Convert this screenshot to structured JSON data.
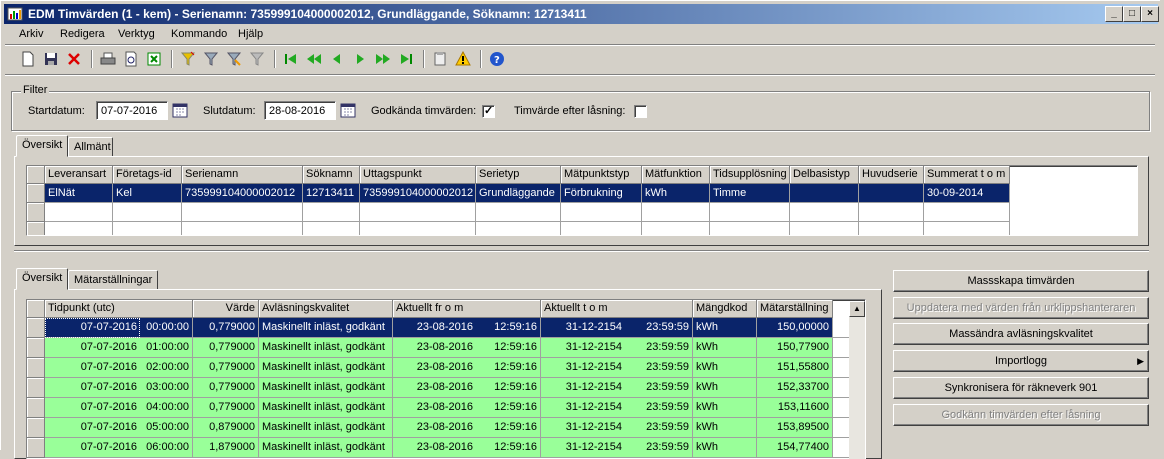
{
  "window": {
    "title": "EDM Timvärden (1 - kem) - Serienamn: 735999104000002012, Grundläggande, Söknamn: 12713411"
  },
  "menu": [
    "Arkiv",
    "Redigera",
    "Verktyg",
    "Kommando",
    "Hjälp"
  ],
  "filter": {
    "group_label": "Filter",
    "start_label": "Startdatum:",
    "start_value": "07-07-2016",
    "end_label": "Slutdatum:",
    "end_value": "28-08-2016",
    "approved_label": "Godkända timvärden:",
    "approved_checked": true,
    "after_lock_label": "Timvärde efter låsning:",
    "after_lock_checked": false
  },
  "upper_tabs": [
    "Översikt",
    "Allmänt"
  ],
  "series_table": {
    "columns": [
      "Leveransart",
      "Företags-id",
      "Serienamn",
      "Söknamn",
      "Uttagspunkt",
      "Serietyp",
      "Mätpunktstyp",
      "Mätfunktion",
      "Tidsupplösning",
      "Delbasistyp",
      "Huvudserie",
      "Summerat t o m"
    ],
    "rows": [
      [
        "ElNät",
        "Kel",
        "735999104000002012",
        "12713411",
        "735999104000002012",
        "Grundläggande",
        "Förbrukning",
        "kWh",
        "Timme",
        "",
        "",
        "30-09-2014"
      ]
    ]
  },
  "lower_tabs": [
    "Översikt",
    "Mätarställningar"
  ],
  "values_table": {
    "columns": [
      "Tidpunkt (utc)",
      "Värde",
      "Avläsningskvalitet",
      "Aktuellt fr o m",
      "Aktuellt t o m",
      "Mängdkod",
      "Mätarställning"
    ],
    "rows": [
      [
        "07-07-2016",
        "00:00:00",
        "0,779000",
        "Maskinellt inläst, godkänt",
        "23-08-2016",
        "12:59:16",
        "31-12-2154",
        "23:59:59",
        "kWh",
        "150,00000"
      ],
      [
        "07-07-2016",
        "01:00:00",
        "0,779000",
        "Maskinellt inläst, godkänt",
        "23-08-2016",
        "12:59:16",
        "31-12-2154",
        "23:59:59",
        "kWh",
        "150,77900"
      ],
      [
        "07-07-2016",
        "02:00:00",
        "0,779000",
        "Maskinellt inläst, godkänt",
        "23-08-2016",
        "12:59:16",
        "31-12-2154",
        "23:59:59",
        "kWh",
        "151,55800"
      ],
      [
        "07-07-2016",
        "03:00:00",
        "0,779000",
        "Maskinellt inläst, godkänt",
        "23-08-2016",
        "12:59:16",
        "31-12-2154",
        "23:59:59",
        "kWh",
        "152,33700"
      ],
      [
        "07-07-2016",
        "04:00:00",
        "0,779000",
        "Maskinellt inläst, godkänt",
        "23-08-2016",
        "12:59:16",
        "31-12-2154",
        "23:59:59",
        "kWh",
        "153,11600"
      ],
      [
        "07-07-2016",
        "05:00:00",
        "0,879000",
        "Maskinellt inläst, godkänt",
        "23-08-2016",
        "12:59:16",
        "31-12-2154",
        "23:59:59",
        "kWh",
        "153,89500"
      ],
      [
        "07-07-2016",
        "06:00:00",
        "1,879000",
        "Maskinellt inläst, godkänt",
        "23-08-2016",
        "12:59:16",
        "31-12-2154",
        "23:59:59",
        "kWh",
        "154,77400"
      ]
    ]
  },
  "actions": [
    {
      "label": "Massskapa timvärden",
      "enabled": true
    },
    {
      "label": "Uppdatera med värden från urklippshanteraren",
      "enabled": false
    },
    {
      "label": "Massändra avläsningskvalitet",
      "enabled": true
    },
    {
      "label": "Importlogg",
      "enabled": true,
      "submenu": true
    },
    {
      "label": "Synkronisera för räkneverk 901",
      "enabled": true
    },
    {
      "label": "Godkänn timvärden efter låsning",
      "enabled": false
    }
  ],
  "colors": {
    "selected_row": "#0a246a",
    "approved_row": "#99ff99",
    "title_start": "#0a246a"
  }
}
